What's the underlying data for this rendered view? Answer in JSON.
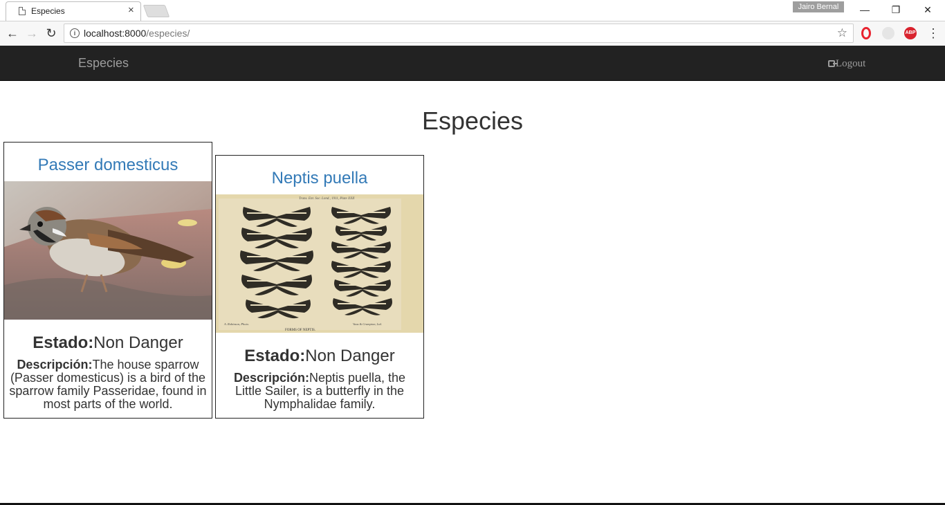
{
  "browser": {
    "tab_title": "Especies",
    "tab_close": "×",
    "profile_name": "Jairo Bernal",
    "window_controls": {
      "minimize": "—",
      "restore": "❐",
      "close": "✕"
    },
    "back": "←",
    "forward": "→",
    "reload": "↻",
    "url_host": "localhost:8000",
    "url_path": "/especies/",
    "star": "☆",
    "abp_label": "ABP",
    "menu": "⋮",
    "info": "i"
  },
  "navbar": {
    "brand": "Especies",
    "logout_label": "Logout"
  },
  "page": {
    "title": "Especies"
  },
  "species": [
    {
      "name": "Passer domesticus",
      "estado_label": "Estado:",
      "estado_value": "Non Danger",
      "descripcion_label": "Descripción:",
      "descripcion_value": "The house sparrow (Passer domesticus) is a bird of the sparrow family Passeridae, found in most parts of the world."
    },
    {
      "name": "Neptis puella",
      "estado_label": "Estado:",
      "estado_value": "Non Danger",
      "descripcion_label": "Descripción:",
      "descripcion_value": "Neptis puella, the Little Sailer, is a butterfly in the Nymphalidae family.",
      "plate_header": "Trans. Ent. Soc. Lond., 1911, Plate XXII",
      "plate_caption": "FORMS OF NEPTIS.",
      "plate_credit_left": "A. Robinson, Photo.",
      "plate_credit_right": "Vaus & Crampton, Ltd."
    }
  ],
  "colors": {
    "navbar_bg": "#222222",
    "navbar_text": "#9d9d9d",
    "link": "#337ab7"
  }
}
